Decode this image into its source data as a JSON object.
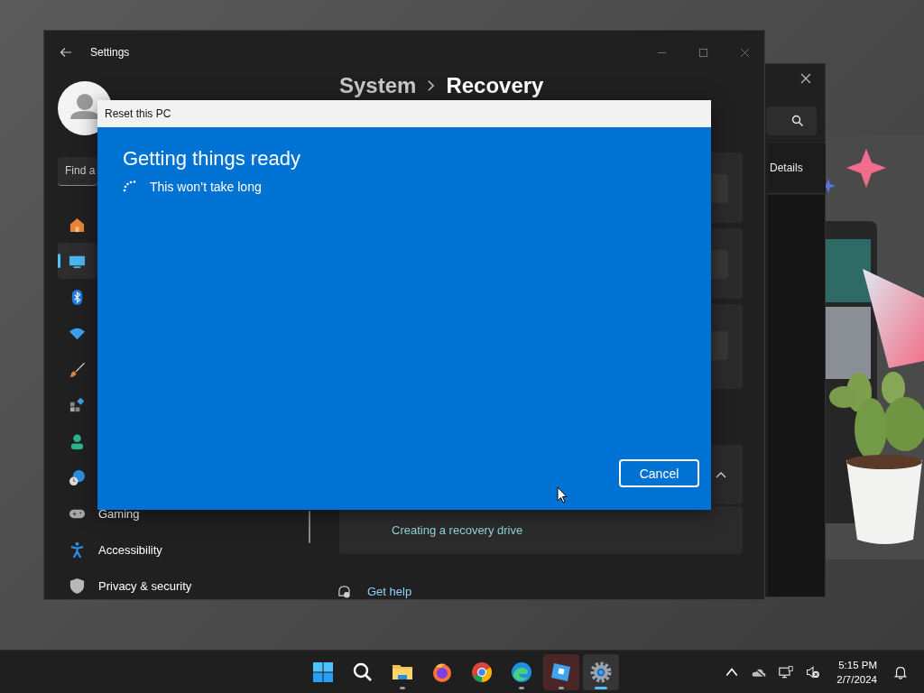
{
  "back_window": {
    "tabs": [
      {
        "label": "Details"
      }
    ]
  },
  "settings_window": {
    "title": "Settings",
    "breadcrumb": [
      "System",
      "Recovery"
    ],
    "search": {
      "placeholder": "Find a"
    },
    "sidebar": {
      "items": [
        {
          "selected": false
        },
        {
          "selected": true
        },
        {
          "selected": false
        },
        {
          "selected": false
        },
        {
          "selected": false
        },
        {
          "selected": false
        },
        {
          "selected": false
        },
        {
          "selected": false
        },
        {
          "label": "Gaming",
          "selected": false
        },
        {
          "label": "Accessibility",
          "selected": false
        },
        {
          "label": "Privacy & security",
          "selected": false
        }
      ]
    },
    "related_links": [
      "Creating a recovery drive"
    ],
    "help_link": "Get help"
  },
  "dialog": {
    "title": "Reset this PC",
    "heading": "Getting things ready",
    "status": "This won’t take long",
    "buttons": [
      "Cancel"
    ]
  },
  "taskbar": {
    "apps": [
      {
        "running": false,
        "selected": false,
        "flashing": false
      },
      {
        "running": false,
        "selected": false,
        "flashing": false
      },
      {
        "running": true,
        "selected": false,
        "flashing": false
      },
      {
        "running": false,
        "selected": false,
        "flashing": false
      },
      {
        "running": false,
        "selected": false,
        "flashing": false
      },
      {
        "running": true,
        "selected": false,
        "flashing": false
      },
      {
        "running": true,
        "selected": false,
        "flashing": true
      },
      {
        "running": true,
        "selected": true,
        "flashing": false
      }
    ],
    "clock": {
      "time": "5:15 PM",
      "date": "2/7/2024"
    }
  }
}
